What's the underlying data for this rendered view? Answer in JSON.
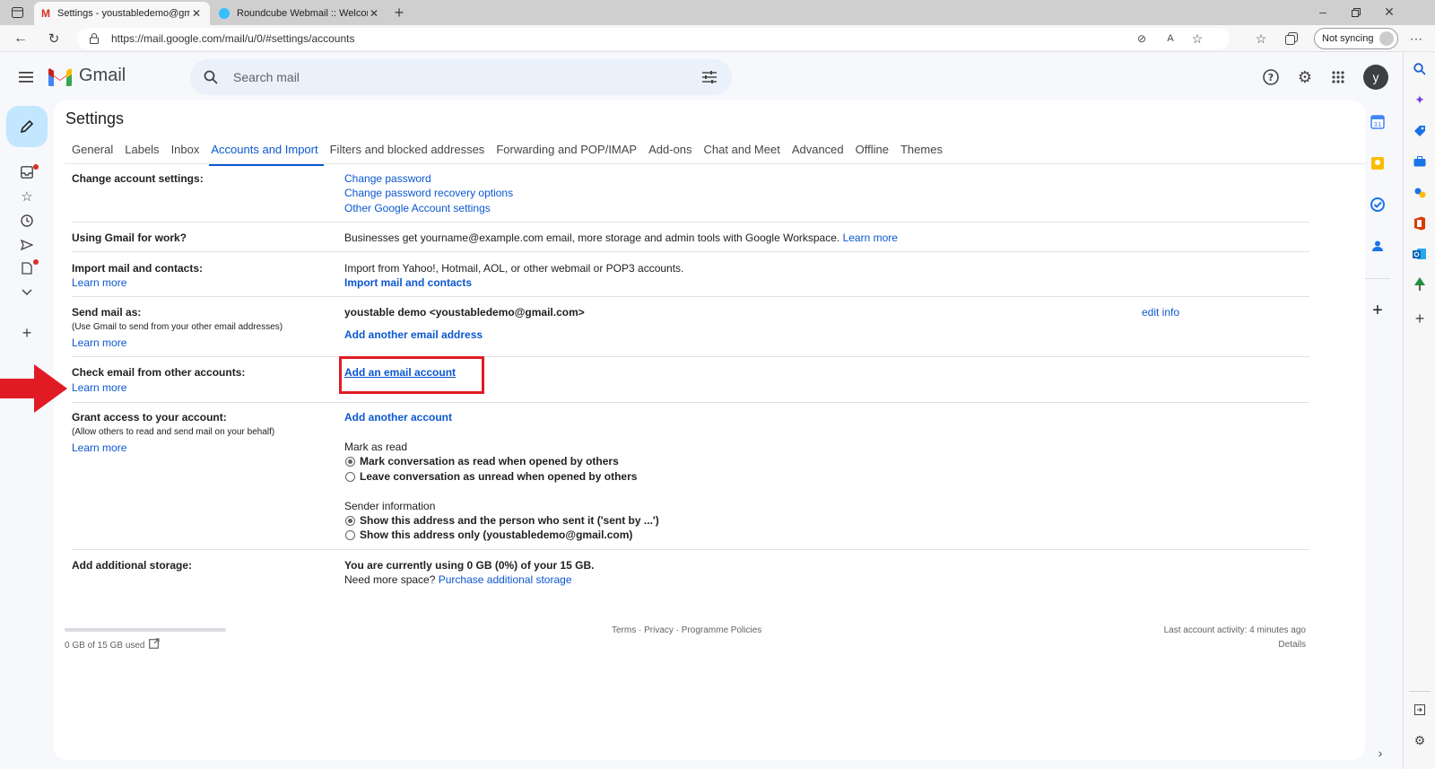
{
  "browser": {
    "tabs": [
      {
        "label": "Settings - youstabledemo@gma",
        "active": true
      },
      {
        "label": "Roundcube Webmail :: Welcome",
        "active": false
      }
    ],
    "url": "https://mail.google.com/mail/u/0/#settings/accounts",
    "sync_label": "Not syncing"
  },
  "gmail": {
    "logo_text": "Gmail",
    "search_placeholder": "Search mail",
    "avatar_letter": "y"
  },
  "settings": {
    "title": "Settings",
    "tabs": [
      "General",
      "Labels",
      "Inbox",
      "Accounts and Import",
      "Filters and blocked addresses",
      "Forwarding and POP/IMAP",
      "Add-ons",
      "Chat and Meet",
      "Advanced",
      "Offline",
      "Themes"
    ],
    "active_tab": "Accounts and Import",
    "change_account": {
      "label": "Change account settings:",
      "links": [
        "Change password",
        "Change password recovery options",
        "Other Google Account settings"
      ]
    },
    "work": {
      "label": "Using Gmail for work?",
      "text": "Businesses get yourname@example.com email, more storage and admin tools with Google Workspace.",
      "link": "Learn more"
    },
    "import": {
      "label": "Import mail and contacts:",
      "learn_more": "Learn more",
      "text": "Import from Yahoo!, Hotmail, AOL, or other webmail or POP3 accounts.",
      "action": "Import mail and contacts"
    },
    "send_as": {
      "label": "Send mail as:",
      "sub": "(Use Gmail to send from your other email addresses)",
      "learn_more": "Learn more",
      "address": "youstable demo <youstabledemo@gmail.com>",
      "edit": "edit info",
      "add": "Add another email address"
    },
    "check_email": {
      "label": "Check email from other accounts:",
      "learn_more": "Learn more",
      "add": "Add an email account"
    },
    "grant_access": {
      "label": "Grant access to your account:",
      "sub": "(Allow others to read and send mail on your behalf)",
      "learn_more": "Learn more",
      "add": "Add another account",
      "mark_read_title": "Mark as read",
      "mark_read_options": [
        "Mark conversation as read when opened by others",
        "Leave conversation as unread when opened by others"
      ],
      "mark_read_selected": 0,
      "sender_info_title": "Sender information",
      "sender_info_options": [
        "Show this address and the person who sent it ('sent by ...')",
        "Show this address only (youstabledemo@gmail.com)"
      ],
      "sender_info_selected": 0
    },
    "storage": {
      "label": "Add additional storage:",
      "usage": "You are currently using 0 GB (0%) of your 15 GB.",
      "need_more": "Need more space?",
      "link": "Purchase additional storage"
    }
  },
  "footer": {
    "storage_used": "0 GB of 15 GB used",
    "storage_fraction": 0,
    "policies": "Terms · Privacy · Programme Policies",
    "last_activity": "Last account activity: 4 minutes ago",
    "details": "Details"
  },
  "colors": {
    "accent": "#0b57d0",
    "highlight": "#e01b24",
    "compose": "#c2e7ff"
  }
}
